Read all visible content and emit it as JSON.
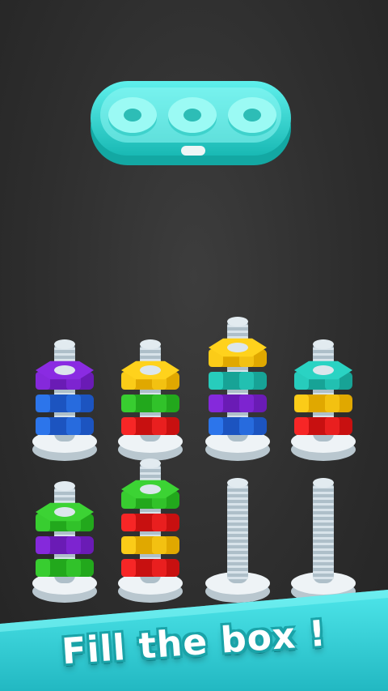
{
  "colors": {
    "purple": [
      "#8a2be2",
      "#6a1bb5"
    ],
    "blue": [
      "#2f7bf2",
      "#1c54c0"
    ],
    "yellow": [
      "#ffd21c",
      "#e0a800"
    ],
    "green": [
      "#3cd334",
      "#22a81c"
    ],
    "red": [
      "#ff2a2a",
      "#c81010"
    ],
    "teal": [
      "#2ad3c3",
      "#17a396"
    ]
  },
  "box": {
    "slots": 3,
    "filled": 0
  },
  "bolts": [
    {
      "nuts": [
        "blue",
        "blue",
        "purple"
      ]
    },
    {
      "nuts": [
        "red",
        "green",
        "yellow"
      ]
    },
    {
      "nuts": [
        "blue",
        "purple",
        "teal",
        "yellow"
      ]
    },
    {
      "nuts": [
        "red",
        "yellow",
        "teal"
      ]
    },
    {
      "nuts": [
        "green",
        "purple",
        "green"
      ]
    },
    {
      "nuts": [
        "red",
        "yellow",
        "red",
        "green"
      ]
    },
    {
      "nuts": []
    },
    {
      "nuts": []
    }
  ],
  "banner": {
    "text": "Fill the box !"
  }
}
